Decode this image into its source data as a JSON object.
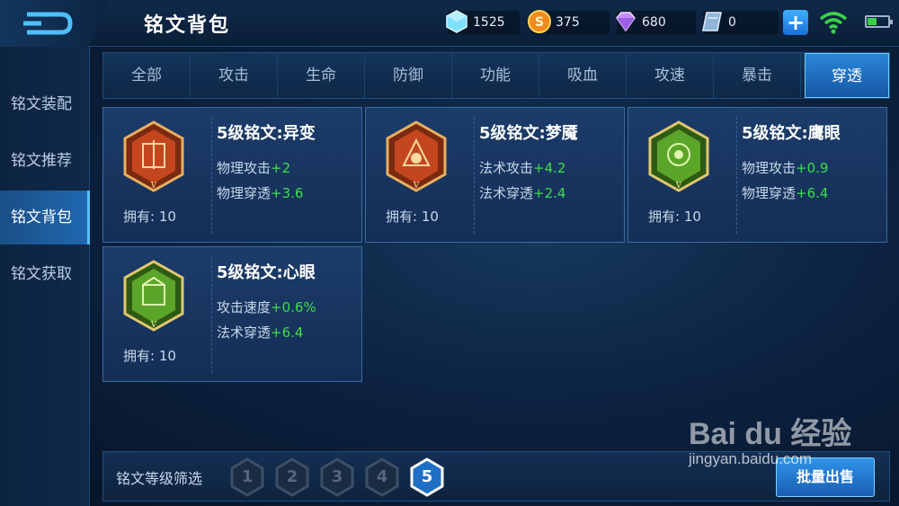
{
  "header": {
    "title": "铭文背包",
    "currencies": [
      {
        "icon": "crystal-icon",
        "value": "1525"
      },
      {
        "icon": "gold-coin-icon",
        "value": "375"
      },
      {
        "icon": "diamond-icon",
        "value": "680"
      },
      {
        "icon": "voucher-icon",
        "value": "0"
      }
    ],
    "plus_label": "+"
  },
  "sidebar": {
    "items": [
      {
        "label": "铭文装配"
      },
      {
        "label": "铭文推荐"
      },
      {
        "label": "铭文背包"
      },
      {
        "label": "铭文获取"
      }
    ],
    "active_index": 2
  },
  "tabs": {
    "items": [
      "全部",
      "攻击",
      "生命",
      "防御",
      "功能",
      "吸血",
      "攻速",
      "暴击",
      "穿透"
    ],
    "active_index": 8
  },
  "cards": [
    {
      "title": "5级铭文:异变",
      "emblem_color": "#c4461f",
      "stats": [
        {
          "name": "物理攻击",
          "value": "+2"
        },
        {
          "name": "物理穿透",
          "value": "+3.6"
        }
      ],
      "owned": "拥有: 10"
    },
    {
      "title": "5级铭文:梦魇",
      "emblem_color": "#c4461f",
      "stats": [
        {
          "name": "法术攻击",
          "value": "+4.2"
        },
        {
          "name": "法术穿透",
          "value": "+2.4"
        }
      ],
      "owned": "拥有: 10"
    },
    {
      "title": "5级铭文:鹰眼",
      "emblem_color": "#5aa52a",
      "stats": [
        {
          "name": "物理攻击",
          "value": "+0.9"
        },
        {
          "name": "物理穿透",
          "value": "+6.4"
        }
      ],
      "owned": "拥有: 10"
    },
    {
      "title": "5级铭文:心眼",
      "emblem_color": "#5aa52a",
      "stats": [
        {
          "name": "攻击速度",
          "value": "+0.6%"
        },
        {
          "name": "法术穿透",
          "value": "+6.4"
        }
      ],
      "owned": "拥有: 10"
    }
  ],
  "filter": {
    "label": "铭文等级筛选",
    "levels": [
      "1",
      "2",
      "3",
      "4",
      "5"
    ],
    "active_level": "5",
    "bulk_sell_label": "批量出售"
  },
  "watermark": {
    "logo_text": "Bai du 经验",
    "url": "jingyan.baidu.com"
  },
  "colors": {
    "accent": "#2a86d8",
    "stat_positive": "#3fdc4c"
  }
}
